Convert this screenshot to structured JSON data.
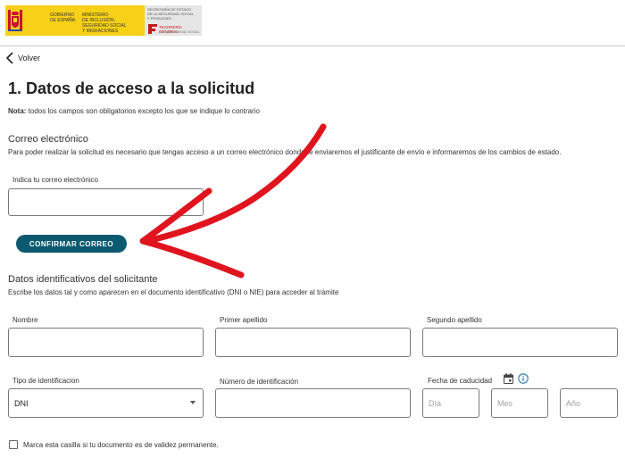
{
  "header": {
    "gov_text_1": [
      "GOBIERNO",
      "DE ESPAÑA"
    ],
    "gov_text_2": [
      "MINISTERIO",
      "DE INCLUSIÓN, SEGURIDAD SOCIAL",
      "Y MIGRACIONES"
    ],
    "agency_text": [
      "SECRETARÍA DE ESTADO",
      "DE LA SEGURIDAD SOCIAL",
      "Y PENSIONES"
    ],
    "agency_name": "TESORERÍA GENERAL",
    "agency_sub": "DE LA SEGURIDAD SOCIAL",
    "gov_color": "#f7d117",
    "agency_red": "#c41a1a"
  },
  "back": {
    "label": "Volver"
  },
  "page": {
    "title": "1. Datos de acceso a la solicitud",
    "note_bold": "Nota:",
    "note_text": " todos los campos son obligatorios excepto los que se indique lo contrario"
  },
  "email_section": {
    "title": "Correo electrónico",
    "description": "Para poder realizar la solicitud es necesario que tengas acceso a un correo electrónico donde te enviaremos el justificante de envío e informaremos de los cambios de estado.",
    "field_label": "Indica tu correo electrónico",
    "field_value": "",
    "confirm_button": "CONFIRMAR CORREO",
    "button_color": "#0b5a70"
  },
  "id_section": {
    "title": "Datos identificativos del solicitante",
    "description": "Escribe los datos tal y como aparecen en el documento identificativo (DNI o NIE) para acceder al trámite",
    "nombre_label": "Nombre",
    "apellido1_label": "Primer apellido",
    "apellido2_label": "Segundo apellido",
    "tipo_label": "Tipo de identificacion",
    "tipo_value": "DNI",
    "numero_label": "Número de identificación",
    "fecha_label": "Fecha de caducidad",
    "dia_placeholder": "Día",
    "mes_placeholder": "Mes",
    "anio_placeholder": "Año",
    "checkbox_label": "Marca esta casilla si tu documento es de validez permanente.",
    "checkbox_checked": false
  },
  "annotation": {
    "arrow_color": "#e0141e"
  }
}
